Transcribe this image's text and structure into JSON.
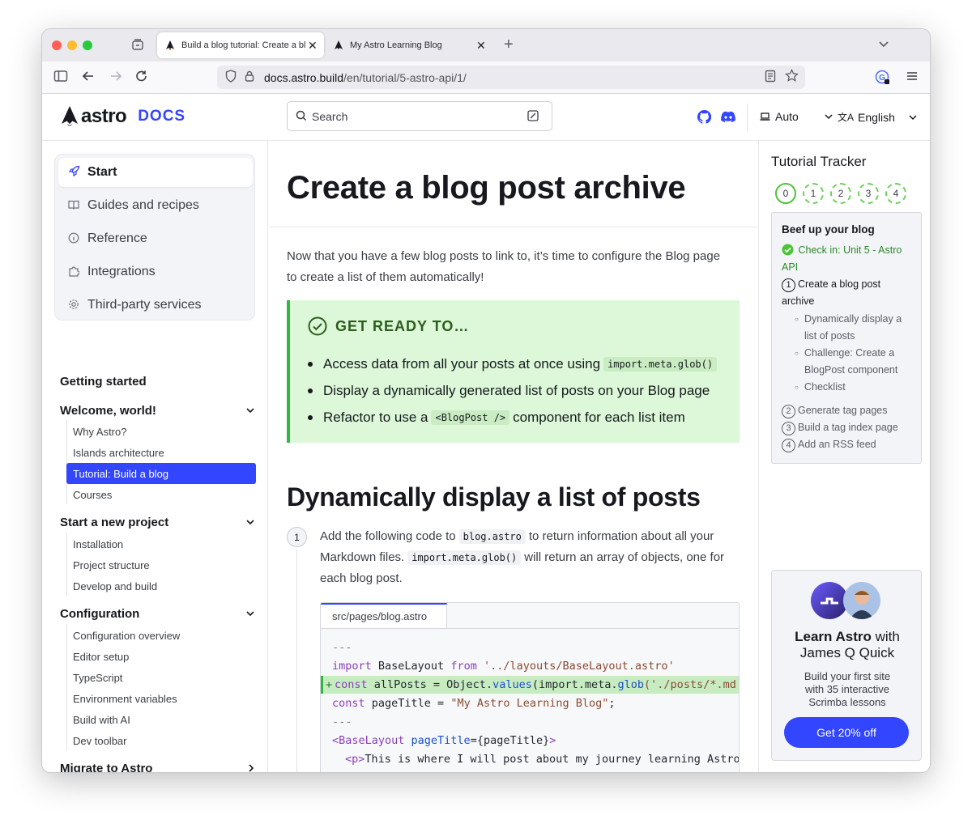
{
  "browser": {
    "tabs": [
      {
        "title": "Build a blog tutorial: Create a bl",
        "close": "✕"
      },
      {
        "title": "My Astro Learning Blog",
        "close": "✕"
      }
    ],
    "new_tab": "+",
    "url_host": "docs.astro.build",
    "url_path": "/en/tutorial/5-astro-api/1/"
  },
  "header": {
    "logo_text": "astro",
    "logo_docs": "DOCS",
    "search_placeholder": "Search",
    "theme_label": "Auto",
    "language_label": "English"
  },
  "sidebar": {
    "top_items": [
      {
        "label": "Start",
        "icon": "rocket-icon"
      },
      {
        "label": "Guides and recipes",
        "icon": "book-icon"
      },
      {
        "label": "Reference",
        "icon": "info-icon"
      },
      {
        "label": "Integrations",
        "icon": "puzzle-icon"
      },
      {
        "label": "Third-party services",
        "icon": "gear-icon"
      }
    ],
    "getting_started": "Getting started",
    "welcome": {
      "title": "Welcome, world!",
      "items": [
        "Why Astro?",
        "Islands architecture",
        "Tutorial: Build a blog",
        "Courses"
      ]
    },
    "start_project": {
      "title": "Start a new project",
      "items": [
        "Installation",
        "Project structure",
        "Develop and build"
      ]
    },
    "configuration": {
      "title": "Configuration",
      "items": [
        "Configuration overview",
        "Editor setup",
        "TypeScript",
        "Environment variables",
        "Build with AI",
        "Dev toolbar"
      ]
    },
    "migrate": "Migrate to Astro"
  },
  "main": {
    "title": "Create a blog post archive",
    "intro_1": "Now that you have a few blog posts to link to, it’s time to configure the Blog page",
    "intro_2": "to create a list of them automatically!",
    "ready": {
      "heading": "GET READY TO…",
      "item1_pre": "Access data from all your posts at once using",
      "item1_code": "import.meta.glob()",
      "item2": "Display a dynamically generated list of posts on your Blog page",
      "item3_pre": "Refactor to use a",
      "item3_code": "<BlogPost />",
      "item3_post": "component for each list item"
    },
    "section_title": "Dynamically display a list of posts",
    "step_number": "1",
    "step_l1_pre": "Add the following code to",
    "step_l1_code": "blog.astro",
    "step_l1_post": "to return information about all your",
    "step_l2_pre": "Markdown files.",
    "step_l2_code": "import.meta.glob()",
    "step_l2_post": "will return an array of objects, one for",
    "step_l3": "each blog post.",
    "code_filename": "src/pages/blog.astro",
    "code": {
      "fence": "---",
      "l2_kw": "import",
      "l2_id": " BaseLayout ",
      "l2_from": "from",
      "l2_str": " '../layouts/BaseLayout.astro'",
      "l3_plus": "+",
      "l3_kw": "const",
      "l3_rest": " allPosts = Object.",
      "l3_fn": "values",
      "l3_mid": "(import.meta.",
      "l3_fn2": "glob",
      "l3_str": "('./posts/*.md',",
      "l4_kw": "const",
      "l4_rest": " pageTitle = ",
      "l4_str": "\"My Astro Learning Blog\"",
      "l4_end": ";",
      "l6_tag": "<BaseLayout",
      "l6_attr": " pageTitle",
      "l6_rest": "={pageTitle}",
      "l6_close": ">",
      "l7_tag": "<p>",
      "l7_text": "This is where I will post about my journey learning Astro.<",
      "l8": "  <"
    }
  },
  "toc": {
    "title": "Tutorial Tracker",
    "dots": [
      "0",
      "1",
      "2",
      "3",
      "4"
    ],
    "unit_title": "Beef up your blog",
    "check_1": "Check in: Unit 5 - Astro",
    "check_2": "API",
    "current_num": "1",
    "current_1": "Create a blog post",
    "current_2": "archive",
    "sub": [
      [
        "Dynamically display a",
        "list of posts"
      ],
      [
        "Challenge: Create a",
        "BlogPost component"
      ],
      [
        "Checklist"
      ]
    ],
    "next": [
      {
        "num": "2",
        "label": "Generate tag pages"
      },
      {
        "num": "3",
        "label": "Build a tag index page"
      },
      {
        "num": "4",
        "label": "Add an RSS feed"
      }
    ],
    "promo": {
      "title_bold": "Learn Astro",
      "title_rest": " with",
      "title_2": "James Q Quick",
      "body_1": "Build your first site",
      "body_2": "with 35 interactive",
      "body_3": "Scrimba lessons",
      "cta": "Get 20% off"
    }
  },
  "colors": {
    "accent": "#3245ff",
    "success": "#2fb941",
    "ready_bg": "#dcf8d8"
  }
}
